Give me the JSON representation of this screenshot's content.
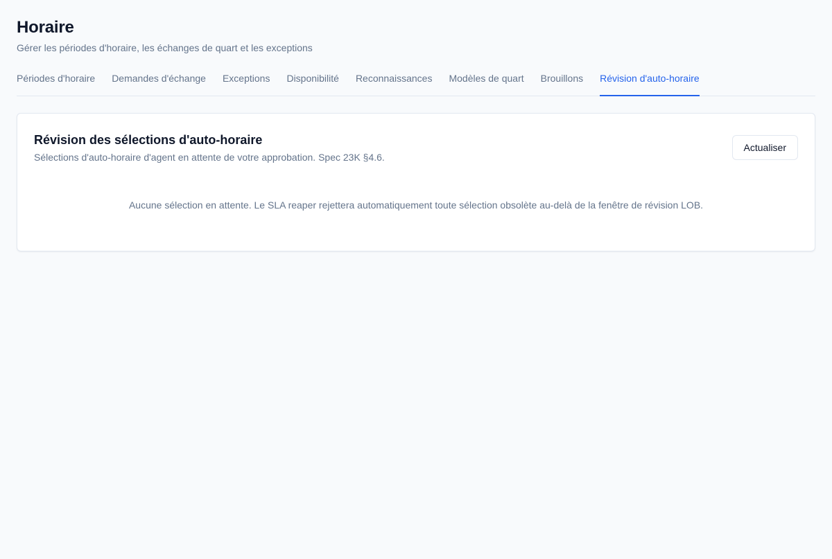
{
  "header": {
    "title": "Horaire",
    "subtitle": "Gérer les périodes d'horaire, les échanges de quart et les exceptions"
  },
  "tabs": [
    {
      "label": "Périodes d'horaire",
      "active": false
    },
    {
      "label": "Demandes d'échange",
      "active": false
    },
    {
      "label": "Exceptions",
      "active": false
    },
    {
      "label": "Disponibilité",
      "active": false
    },
    {
      "label": "Reconnaissances",
      "active": false
    },
    {
      "label": "Modèles de quart",
      "active": false
    },
    {
      "label": "Brouillons",
      "active": false
    },
    {
      "label": "Révision d'auto-horaire",
      "active": true
    }
  ],
  "card": {
    "title": "Révision des sélections d'auto-horaire",
    "description": "Sélections d'auto-horaire d'agent en attente de votre approbation. Spec 23K §4.6.",
    "refresh_label": "Actualiser",
    "empty_message": "Aucune sélection en attente. Le SLA reaper rejettera automatiquement toute sélection obsolète au-delà de la fenêtre de révision LOB."
  },
  "colors": {
    "accent": "#2563eb",
    "muted_text": "#64748b",
    "border": "#e2e8f0",
    "background": "#f8fafc"
  }
}
